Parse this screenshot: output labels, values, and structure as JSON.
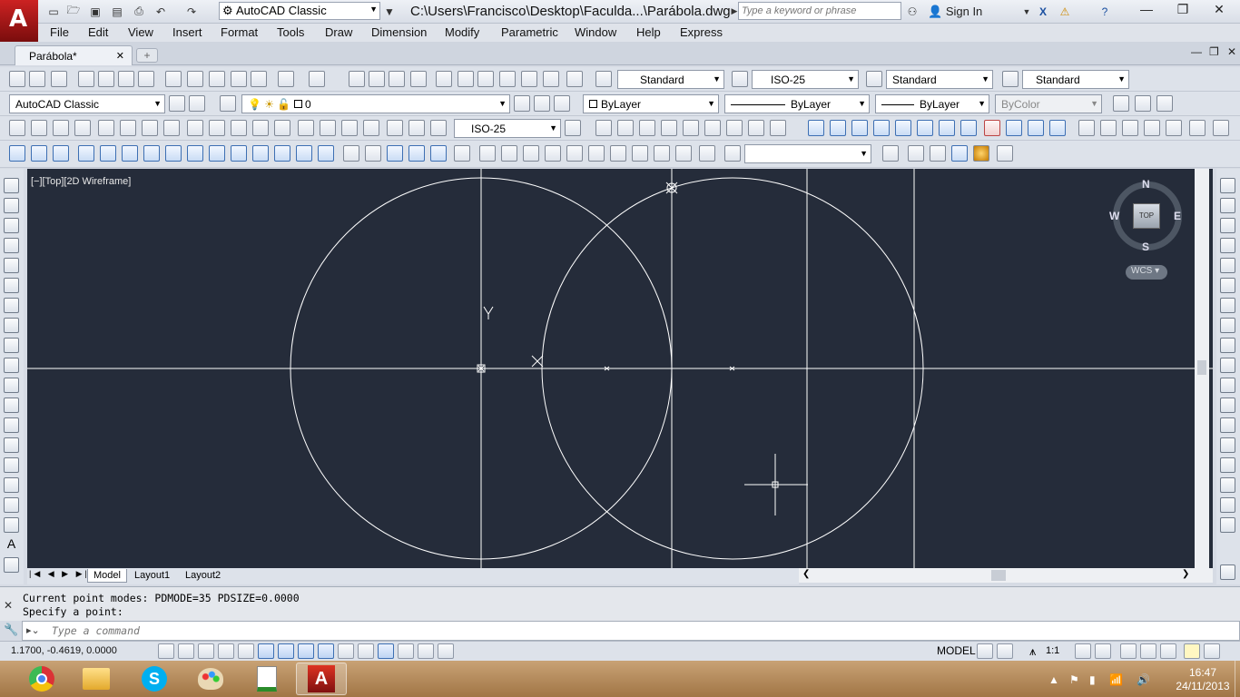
{
  "title_bar": {
    "workspace": "AutoCAD Classic",
    "file_path": "C:\\Users\\Francisco\\Desktop\\Faculda...\\Parábola.dwg",
    "search_placeholder": "Type a keyword or phrase",
    "sign_in": "Sign In"
  },
  "menu": [
    "File",
    "Edit",
    "View",
    "Insert",
    "Format",
    "Tools",
    "Draw",
    "Dimension",
    "Modify",
    "Parametric",
    "Window",
    "Help",
    "Express"
  ],
  "document_tab": "Parábola*",
  "toolbar_styles": {
    "text_style": "Standard",
    "dim_style": "ISO-25",
    "table_style": "Standard",
    "multileader_style": "Standard"
  },
  "toolbar_layers": {
    "workspace": "AutoCAD Classic",
    "layer": "0",
    "color": "ByLayer",
    "linetype": "ByLayer",
    "lineweight": "ByLayer",
    "plot_style": "ByColor"
  },
  "toolbar_dim": {
    "dim_style": "ISO-25"
  },
  "viewport": {
    "label": "[−][Top][2D Wireframe]",
    "ucs_y": "Y",
    "ucs_x": "X"
  },
  "viewcube": {
    "north": "N",
    "south": "S",
    "east": "E",
    "west": "W",
    "face": "TOP",
    "wcs": "WCS"
  },
  "layout_tabs": [
    "Model",
    "Layout1",
    "Layout2"
  ],
  "command": {
    "history_1": "Current point modes:  PDMODE=35  PDSIZE=0.0000",
    "history_2": "Specify a point:",
    "placeholder": "Type a command"
  },
  "status": {
    "coordinates": "1.1700, -0.4619, 0.0000",
    "space": "MODEL",
    "annotation_scale": "1:1"
  },
  "taskbar": {
    "time": "16:47",
    "date": "24/11/2013"
  },
  "colors": {
    "canvas_bg": "#252c3a",
    "drawing_line": "#ffffff",
    "accent_red": "#c22222"
  }
}
